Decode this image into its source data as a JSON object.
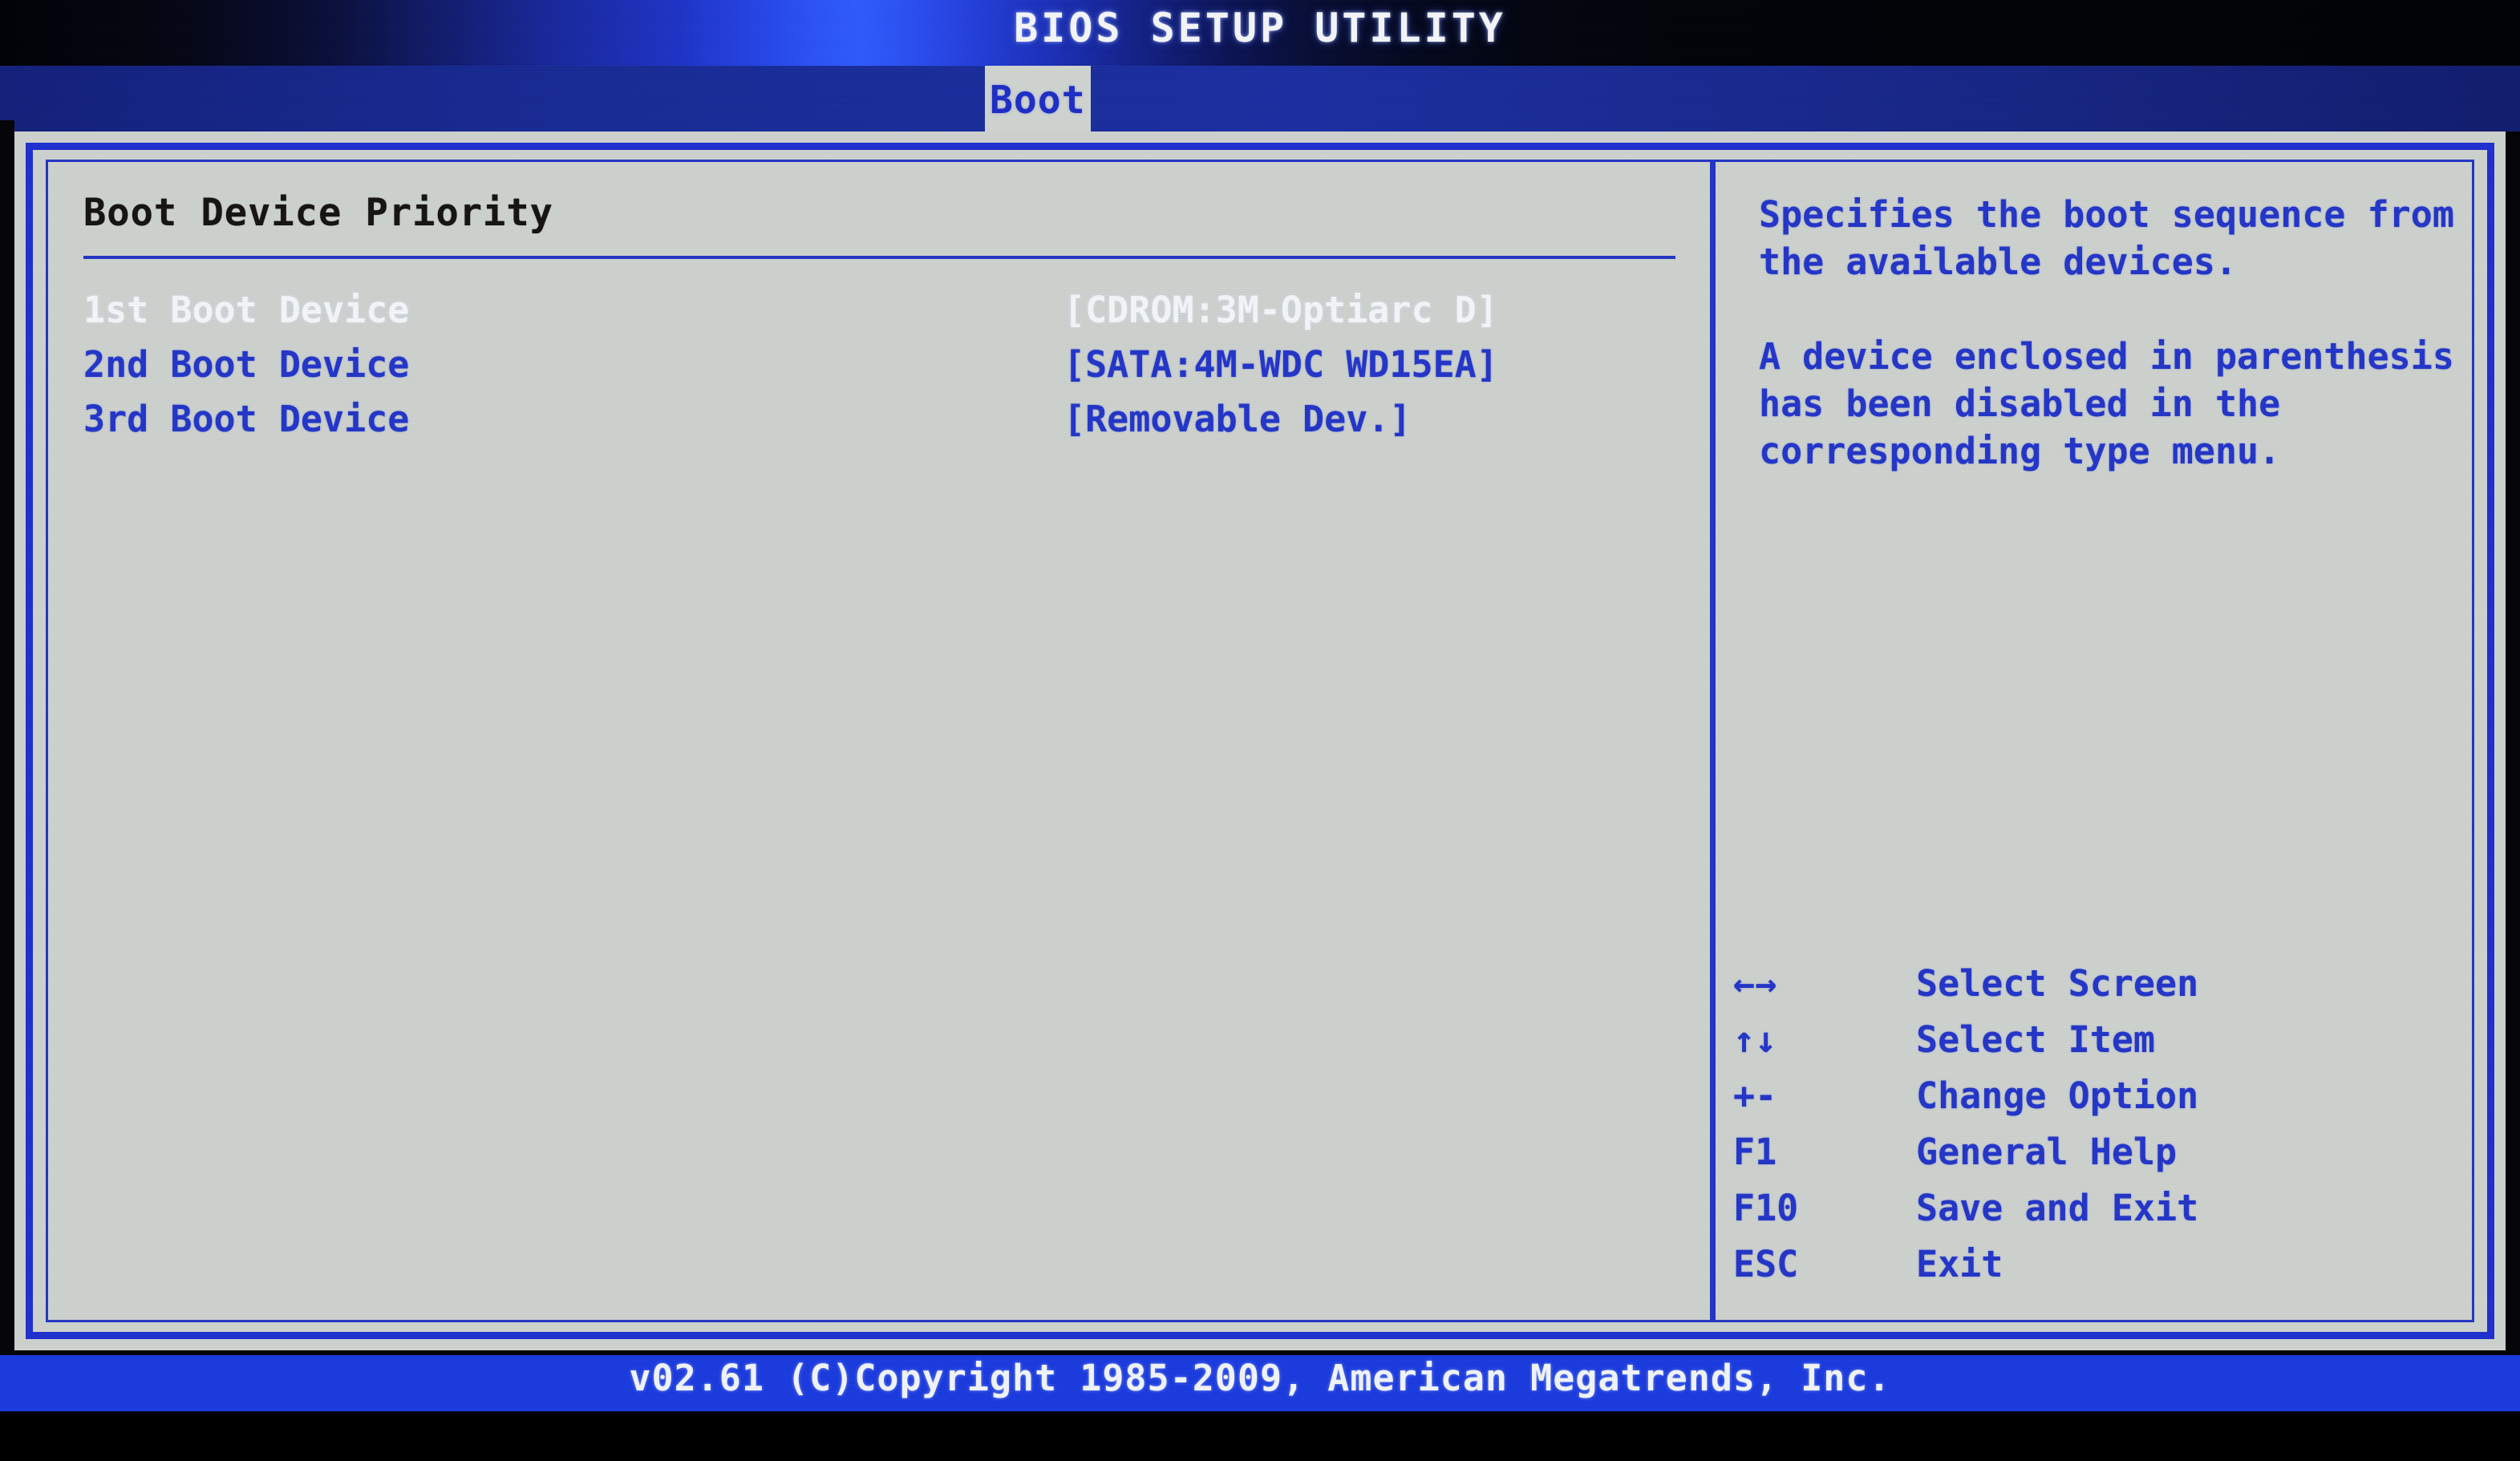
{
  "titlebar": {
    "app_title": "BIOS SETUP UTILITY"
  },
  "menubar": {
    "active_tab": "Boot"
  },
  "main": {
    "section_title": "Boot Device Priority",
    "rows": [
      {
        "label": "1st Boot Device",
        "value": "[CDROM:3M-Optiarc D]",
        "selected": true
      },
      {
        "label": "2nd Boot Device",
        "value": "[SATA:4M-WDC WD15EA]",
        "selected": false
      },
      {
        "label": "3rd Boot Device",
        "value": "[Removable Dev.]",
        "selected": false
      }
    ]
  },
  "help": {
    "paragraphs": [
      "Specifies the boot sequence from the available devices.",
      "A device enclosed in parenthesis has been disabled in the corresponding type menu."
    ],
    "keys": [
      {
        "key": "←→",
        "action": "Select Screen",
        "icon": "left-right-arrow-icon"
      },
      {
        "key": "↑↓",
        "action": "Select Item",
        "icon": "up-down-arrow-icon"
      },
      {
        "key": "+-",
        "action": "Change Option",
        "icon": "plus-minus-icon"
      },
      {
        "key": "F1",
        "action": "General Help",
        "icon": "f1-key-icon"
      },
      {
        "key": "F10",
        "action": "Save and Exit",
        "icon": "f10-key-icon"
      },
      {
        "key": "ESC",
        "action": "Exit",
        "icon": "esc-key-icon"
      }
    ]
  },
  "footer": {
    "copyright": "v02.61 (C)Copyright 1985-2009, American Megatrends, Inc."
  },
  "colors": {
    "panel_background": "#ced2ce",
    "border_blue": "#1f2fd0",
    "text_blue": "#2335c8",
    "text_selected": "#f4f6f8",
    "text_heading": "#15130f",
    "menubar_blue": "#172a95",
    "footer_blue": "#1a3ae0"
  }
}
